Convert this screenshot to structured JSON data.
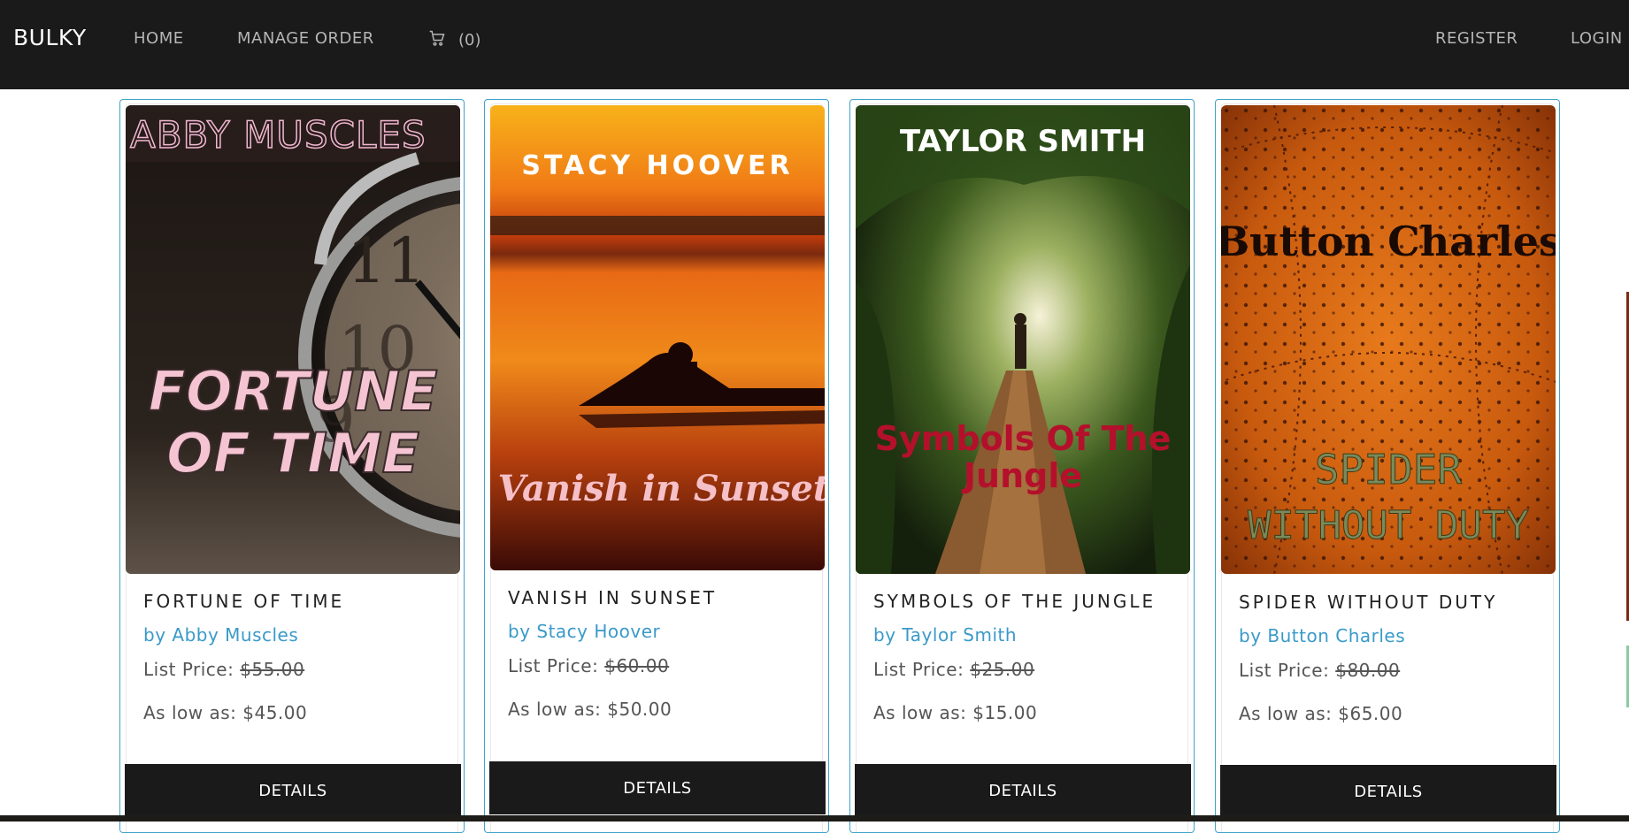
{
  "navbar": {
    "brand": "BULKY",
    "links": {
      "home": "HOME",
      "manage_order": "MANAGE ORDER",
      "register": "REGISTER",
      "login": "LOGIN"
    },
    "cart": {
      "icon": "cart-icon",
      "count": "(0)"
    }
  },
  "products": [
    {
      "cover": {
        "author_text": "ABBY MUSCLES",
        "title_line1": "FORTUNE",
        "title_line2": "OF TIME",
        "scene": "alarm-clock"
      },
      "title": "FORTUNE OF TIME",
      "author": "by Abby Muscles",
      "list_price_label": "List Price:",
      "list_price": "$55.00",
      "low_price": "As low as: $45.00",
      "button": "DETAILS"
    },
    {
      "cover": {
        "author_text": "STACY HOOVER",
        "title_line1": "Vanish in Sunset",
        "scene": "sunset-lake"
      },
      "title": "VANISH IN SUNSET",
      "author": "by Stacy Hoover",
      "list_price_label": "List Price:",
      "list_price": "$60.00",
      "low_price": "As low as: $50.00",
      "button": "DETAILS"
    },
    {
      "cover": {
        "author_text": "TAYLOR SMITH",
        "title_line1": "Symbols Of The",
        "title_line2": "Jungle",
        "scene": "jungle-bridge"
      },
      "title": "SYMBOLS OF THE JUNGLE",
      "author": "by Taylor Smith",
      "list_price_label": "List Price:",
      "list_price": "$25.00",
      "low_price": "As low as: $15.00",
      "button": "DETAILS"
    },
    {
      "cover": {
        "author_text": "Button Charles",
        "title_line1": "SPIDER",
        "title_line2": "WITHOUT DUTY",
        "scene": "spider-web"
      },
      "title": "SPIDER WITHOUT DUTY",
      "author": "by Button Charles",
      "list_price_label": "List Price:",
      "list_price": "$80.00",
      "low_price": "As low as: $65.00",
      "button": "DETAILS"
    }
  ],
  "colors": {
    "navbar": "#1a1a1a",
    "accent": "#3a9ac9",
    "card_border": "#3fa2c9",
    "button": "#1a1a1a"
  }
}
